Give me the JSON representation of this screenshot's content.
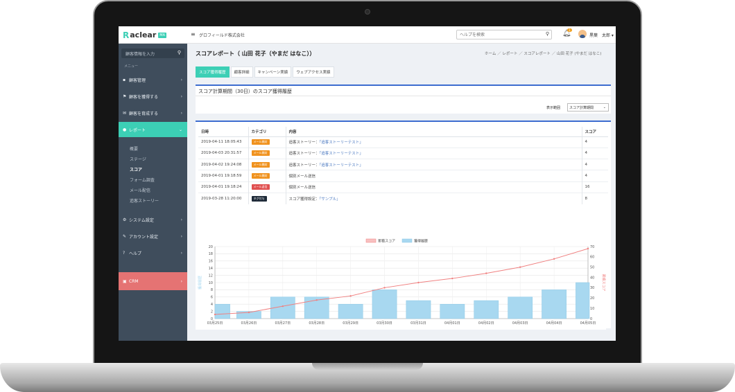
{
  "app": {
    "logo_mark": "R",
    "logo_text": "aclear",
    "logo_badge": "MA",
    "company": "グロフィールド株式会社",
    "help_placeholder": "ヘルプを検索",
    "notification_count": "1",
    "user_name": "黒葉　太郎"
  },
  "sidebar": {
    "search_placeholder": "顧客情報を入力",
    "menu_heading": "メニュー",
    "items": [
      {
        "label": "顧客管理",
        "icon": "user-icon"
      },
      {
        "label": "顧客を獲得する",
        "icon": "flag-icon"
      },
      {
        "label": "顧客を育成する",
        "icon": "mail-icon"
      },
      {
        "label": "レポート",
        "icon": "pie-chart-icon"
      },
      {
        "label": "システム設定",
        "icon": "gear-icon"
      },
      {
        "label": "アカウント設定",
        "icon": "wrench-icon"
      },
      {
        "label": "ヘルプ",
        "icon": "question-icon"
      },
      {
        "label": "CRM",
        "icon": "crm-icon"
      }
    ],
    "report_sub": [
      "概要",
      "ステージ",
      "スコア",
      "フォーム調査",
      "メール配信",
      "追客ストーリー"
    ]
  },
  "page": {
    "title": "スコアレポート（ 山田 花子（やまだ はなこ））",
    "breadcrumbs": "ホーム ／ レポート ／ スコアレポート ／ 山田 花子 (やまだ はなこ)",
    "tabs": [
      "スコア獲得履歴",
      "顧客詳細",
      "キャンペーン実績",
      "ウェブアクセス実績"
    ],
    "panel_title": "スコア計算期間（30日）のスコア獲得履歴",
    "display_label": "表示範囲",
    "display_value": "スコア計算期間"
  },
  "table": {
    "headers": [
      "日時",
      "カテゴリ",
      "内容",
      "スコア"
    ],
    "rows": [
      {
        "date": "2019-04-11 18:05:43",
        "category": "メール開封",
        "cat_color": "#f0921e",
        "content_pre": "追客ストーリー：",
        "content_link": "「追客ストーリーテスト」",
        "score": "4"
      },
      {
        "date": "2019-04-03 20:31:57",
        "category": "メール開封",
        "cat_color": "#f0921e",
        "content_pre": "追客ストーリー：",
        "content_link": "「追客ストーリーテスト」",
        "score": "4"
      },
      {
        "date": "2019-04-02 19:24:08",
        "category": "メール開封",
        "cat_color": "#f0921e",
        "content_pre": "追客ストーリー：",
        "content_link": "「追客ストーリーテスト」",
        "score": "4"
      },
      {
        "date": "2019-04-01 19:18:59",
        "category": "メール開封",
        "cat_color": "#f0921e",
        "content_pre": "個別メール送信",
        "content_link": "",
        "score": "4"
      },
      {
        "date": "2019-04-01 19:18:24",
        "category": "メール返信",
        "cat_color": "#e05050",
        "content_pre": "個別メール送信",
        "content_link": "",
        "score": "16"
      },
      {
        "date": "2019-03-28 11:20:00",
        "category": "タグ付与",
        "cat_color": "#1e2a38",
        "content_pre": "スコア獲得設定：",
        "content_link": "「サンプル」",
        "score": "8"
      }
    ]
  },
  "chart_data": {
    "type": "bar",
    "categories": [
      "03月25日",
      "03月26日",
      "03月27日",
      "03月28日",
      "03月29日",
      "03月30日",
      "03月31日",
      "04月01日",
      "04月02日",
      "04月03日",
      "04月04日",
      "04月05日"
    ],
    "series": [
      {
        "name": "獲得履歴",
        "type": "bar",
        "axis": "left",
        "color": "#a8d8f0",
        "values": [
          4,
          2,
          6,
          6,
          4,
          8,
          5,
          4,
          5,
          6,
          8,
          10
        ]
      },
      {
        "name": "累積スコア",
        "type": "line",
        "axis": "right",
        "color": "#f08080",
        "values": [
          4,
          6,
          12,
          18,
          22,
          30,
          35,
          39,
          44,
          50,
          58,
          68
        ]
      }
    ],
    "ylabel_left": "獲得履歴",
    "ylabel_right": "累積スコア",
    "ylim_left": [
      0,
      20
    ],
    "ylim_right": [
      0,
      70
    ],
    "yticks_left": [
      0,
      2,
      4,
      6,
      8,
      10,
      12,
      14,
      16,
      18,
      20
    ],
    "yticks_right": [
      0,
      10,
      20,
      30,
      40,
      50,
      60,
      70
    ],
    "legend": "top-center",
    "grid": true
  }
}
